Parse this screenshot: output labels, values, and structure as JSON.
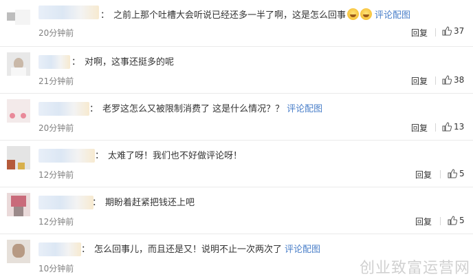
{
  "comments": [
    {
      "text": "之前上那个吐槽大会听说已经还多一半了啊，这是怎么回事",
      "emojis": [
        "laughing-crying-icon",
        "laughing-crying-icon"
      ],
      "link": "评论配图",
      "time": "20分钟前",
      "reply": "回复",
      "likes": "37"
    },
    {
      "text": "对啊，这事还挺多的呢",
      "emojis": [],
      "link": "",
      "time": "21分钟前",
      "reply": "回复",
      "likes": "38"
    },
    {
      "text": "老罗这怎么又被限制消费了 这是什么情况？？",
      "emojis": [],
      "link": "评论配图",
      "time": "20分钟前",
      "reply": "回复",
      "likes": "13"
    },
    {
      "text": "太难了呀！我们也不好做评论呀！",
      "emojis": [],
      "link": "",
      "time": "12分钟前",
      "reply": "回复",
      "likes": "5"
    },
    {
      "text": "期盼着赶紧把钱还上吧",
      "emojis": [],
      "link": "",
      "time": "12分钟前",
      "reply": "回复",
      "likes": "5"
    },
    {
      "text": "怎么回事儿，而且还是又！说明不止一次两次了",
      "emojis": [],
      "link": "评论配图",
      "time": "10分钟前",
      "reply": "",
      "likes": ""
    }
  ],
  "watermark": "创业致富运营网",
  "colors": {
    "link": "#4a7fc9",
    "time": "#808080"
  }
}
